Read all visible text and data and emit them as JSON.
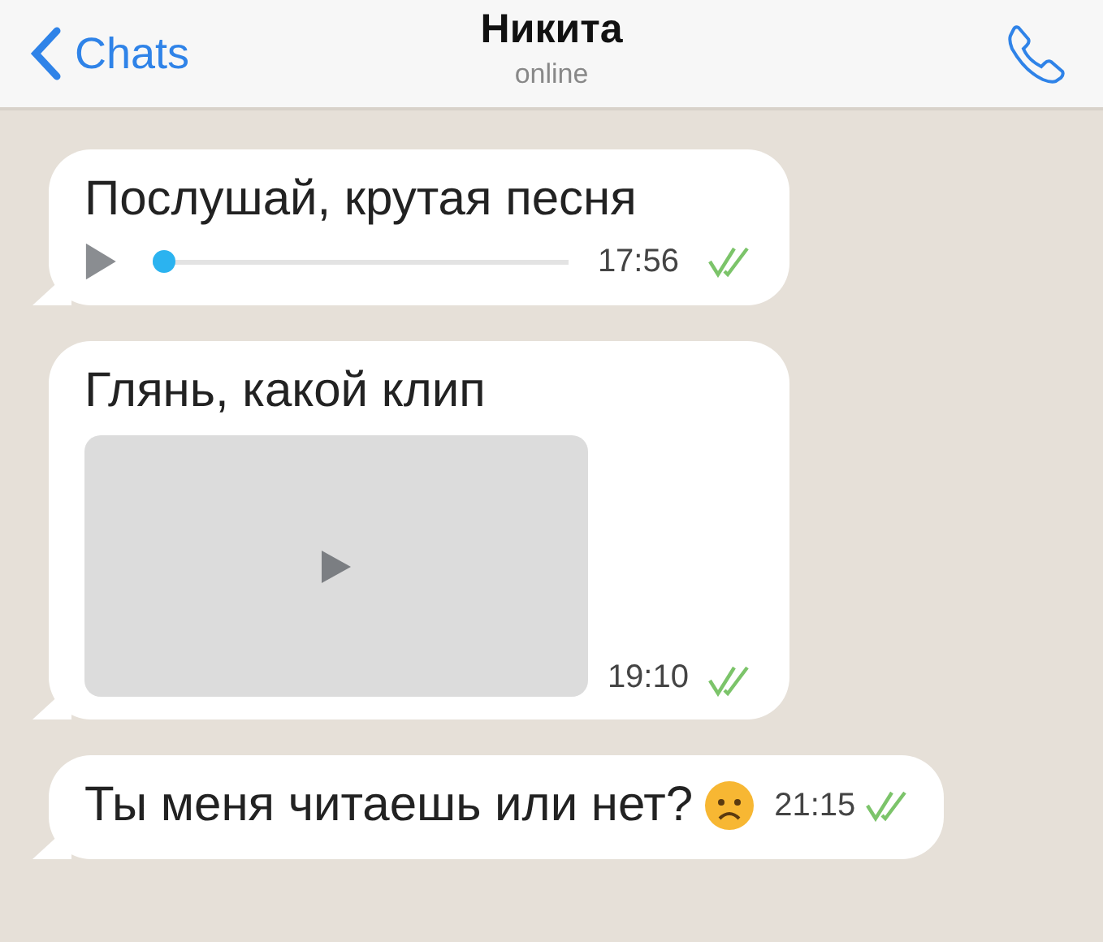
{
  "header": {
    "back_label": "Chats",
    "title": "Никита",
    "status": "online"
  },
  "messages": [
    {
      "kind": "audio",
      "text": "Послушай, крутая песня",
      "level": 0.0,
      "time": "17:56",
      "read": true
    },
    {
      "kind": "video",
      "text": "Глянь, какой клип",
      "time": "19:10",
      "read": true
    },
    {
      "kind": "text",
      "text": "Ты меня читаешь или нет?",
      "emoji": true,
      "time": "21:15",
      "read": true
    }
  ]
}
